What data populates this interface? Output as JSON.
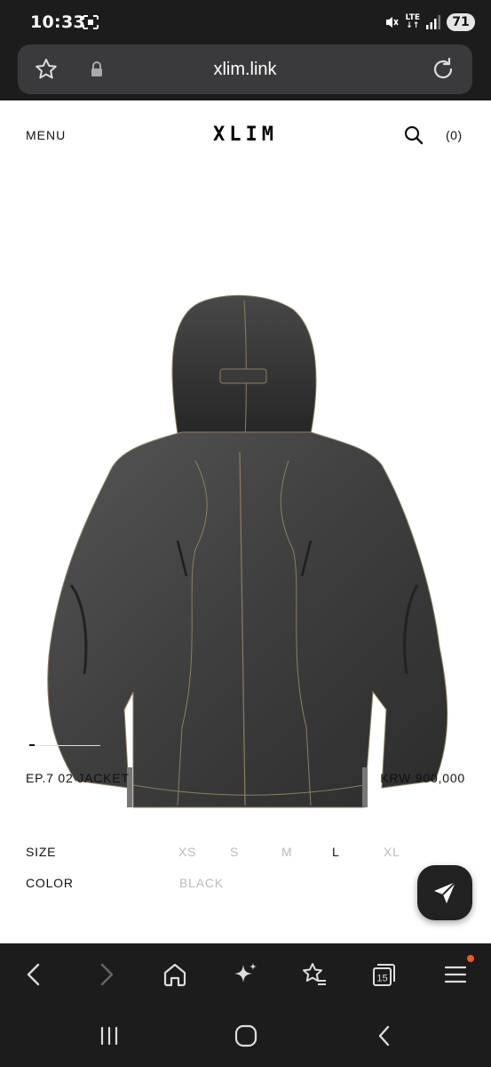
{
  "status_bar": {
    "time": "10:33",
    "network": "LTE",
    "battery": "71",
    "icons": [
      "screen-record-icon",
      "mute-icon",
      "lte-icon",
      "signal-icon",
      "battery-icon"
    ]
  },
  "browser": {
    "url": "xlim.link",
    "icons": [
      "favorite-star-icon",
      "lock-icon",
      "reload-icon"
    ]
  },
  "header": {
    "menu_label": "MENU",
    "logo": "XLIM",
    "cart_label": "(0)"
  },
  "product": {
    "image_alt": "",
    "name": "EP.7 02 JACKET",
    "price": "KRW 900,000",
    "gallery_position": 0.06
  },
  "options": {
    "size_label": "SIZE",
    "sizes": [
      "XS",
      "S",
      "M",
      "L",
      "XL"
    ],
    "selected_size": "L",
    "color_label": "COLOR",
    "color_value": "BLACK"
  },
  "bottom_bar": {
    "buttons": [
      "back-icon",
      "forward-icon",
      "home-icon",
      "ai-sparkle-icon",
      "bookmarks-icon",
      "tabs-icon",
      "menu-icon"
    ],
    "tab_count": "15"
  },
  "system_nav": [
    "recent-apps-icon",
    "home-circle-icon",
    "system-back-icon"
  ],
  "colors": {
    "chrome_bg": "#1c1c1c",
    "url_bar_bg": "#3a3a3c",
    "page_bg": "#ffffff",
    "text_primary": "#111111",
    "text_disabled": "#bbbbbb",
    "notification_dot": "#f05a28"
  }
}
